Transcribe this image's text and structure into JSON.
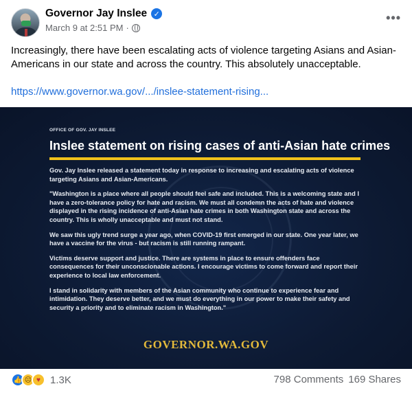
{
  "post": {
    "author": "Governor Jay Inslee",
    "timestamp": "March 9 at 2:51 PM",
    "separator": "·",
    "more_icon": "more-options-icon",
    "text": "Increasingly, there have been escalating acts of violence targeting Asians and Asian-Americans in our state and across the country. This absolutely unacceptable.",
    "link_text": "https://www.governor.wa.gov/.../inslee-statement-rising..."
  },
  "image": {
    "office_label": "OFFICE OF GOV. JAY INSLEE",
    "title": "Inslee statement on rising cases of anti-Asian hate crimes",
    "paragraphs": [
      "Gov. Jay Inslee released a statement today in response to increasing and escalating acts of violence targeting Asians and Asian-Americans.",
      "\"Washington is a place where all people should feel safe and included. This is a welcoming state and I have a zero-tolerance policy for hate and racism. We must all condemn the acts of hate and violence displayed in the rising incidence of anti-Asian hate crimes in both Washington state and across the country. This is wholly unacceptable and must not stand.",
      "We saw this ugly trend surge a year ago, when COVID-19 first emerged in our state. One year later, we have a vaccine for the virus - but racism is still running rampant.",
      "Victims deserve support and justice. There are systems in place to ensure offenders face consequences for their unconscionable actions. I encourage victims to come forward and report their experience to local law enforcement.",
      "I stand in solidarity with members of the Asian community who continue to experience fear and intimidation. They deserve better, and we must do everything in our power to make their safety and security a priority and to eliminate racism in Washington.\""
    ],
    "footer_url": "GOVERNOR.WA.GOV"
  },
  "footer": {
    "reaction_count": "1.3K",
    "comments": "798 Comments",
    "shares": "169 Shares"
  },
  "colors": {
    "link": "#216fdb",
    "accent_yellow": "#f1c21b",
    "image_bg": "#0d1a33"
  }
}
